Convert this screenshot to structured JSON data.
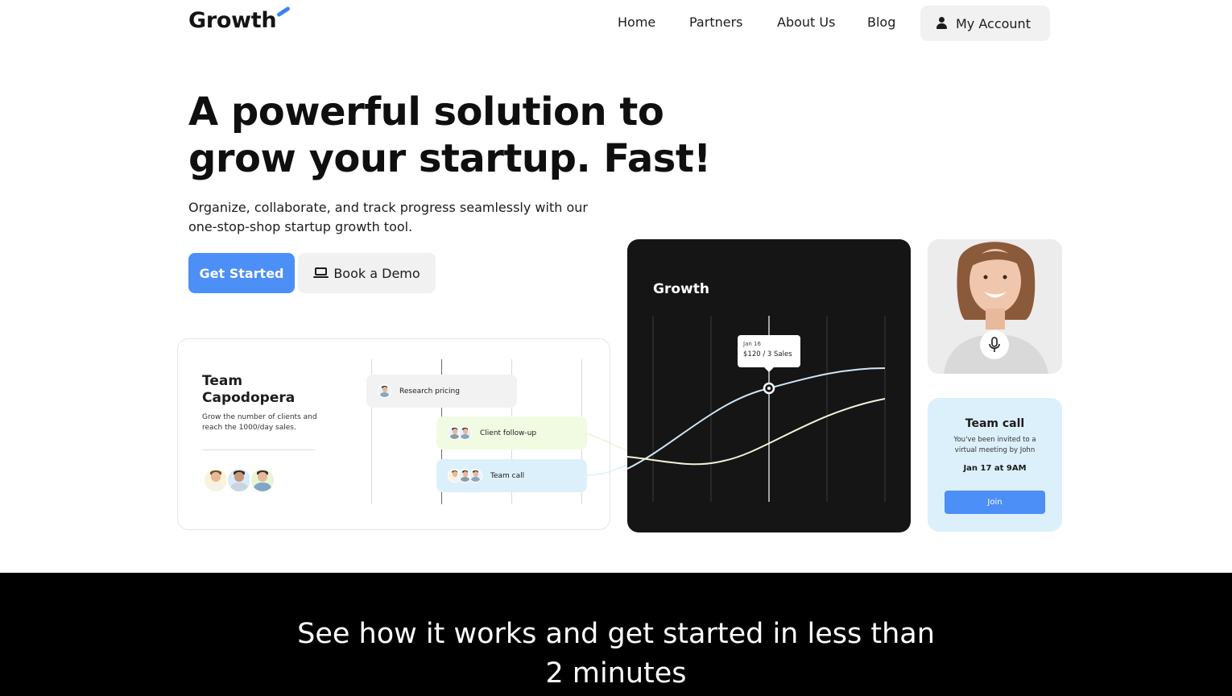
{
  "header": {
    "logo": "Growth",
    "nav": [
      "Home",
      "Partners",
      "About Us",
      "Blog"
    ],
    "account_label": "My Account"
  },
  "hero": {
    "title": "A powerful solution to grow your startup. Fast!",
    "subtitle": "Organize, collaborate, and track progress seamlessly with our one-stop-shop startup growth tool.",
    "primary_cta": "Get Started",
    "secondary_cta": "Book a Demo"
  },
  "team_card": {
    "title": "Team Capodopera",
    "description": "Grow the number of clients and reach the 1000/day sales.",
    "tasks": [
      "Research pricing",
      "Client follow-up",
      "Team call"
    ]
  },
  "growth_card": {
    "title": "Growth",
    "tooltip_date": "Jan 16",
    "tooltip_value": "$120 / 3 Sales"
  },
  "call_card": {
    "title": "Team call",
    "description": "You've been invited to a virtual meeting by John",
    "date": "Jan 17 at 9AM",
    "join_label": "Join"
  },
  "band": {
    "text": "See how it works and get started in less than 2 minutes"
  },
  "colors": {
    "accent": "#4c8ff6",
    "dark_card": "#151516",
    "call_card_bg": "#dcf0fb",
    "task_green": "#f1fbe2",
    "task_blue": "#dcf0fb"
  },
  "icons": [
    "user-icon",
    "laptop-icon",
    "microphone-icon"
  ]
}
